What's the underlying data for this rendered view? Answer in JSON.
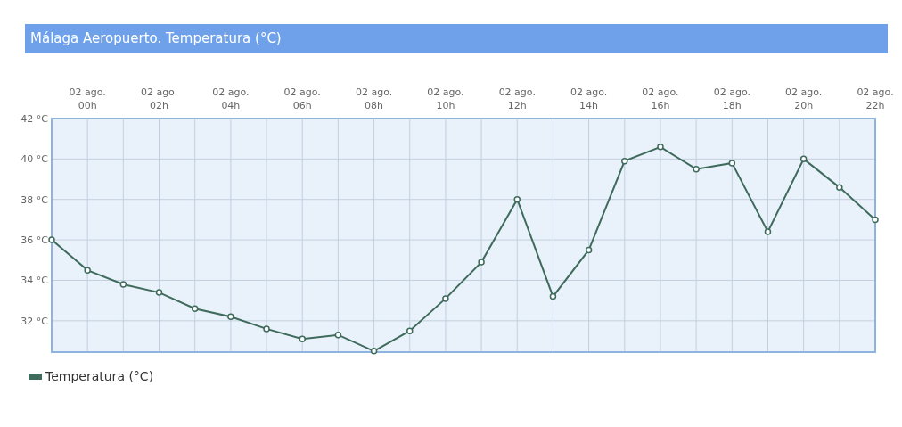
{
  "title": "Málaga Aeropuerto. Temperatura (°C)",
  "chart": {
    "chart_data": {
      "type": "line",
      "categories": [
        null,
        "02 ago. 00h",
        null,
        "02 ago. 02h",
        null,
        "02 ago. 04h",
        null,
        "02 ago. 06h",
        null,
        "02 ago. 08h",
        null,
        "02 ago. 10h",
        null,
        "02 ago. 12h",
        null,
        "02 ago. 14h",
        null,
        "02 ago. 16h",
        null,
        "02 ago. 18h",
        null,
        "02 ago. 20h",
        null,
        "02 ago. 22h"
      ],
      "grid": true,
      "series": [
        {
          "name": "Temperatura (°C)",
          "color": "#3f6b5c",
          "marker": "circle",
          "values": [
            36.0,
            34.5,
            33.8,
            33.4,
            32.6,
            32.2,
            31.6,
            31.1,
            31.3,
            30.5,
            31.5,
            33.1,
            34.9,
            38.0,
            33.2,
            35.5,
            39.9,
            40.6,
            39.5,
            39.8,
            36.4,
            40.0,
            38.6,
            37.0
          ]
        }
      ],
      "ylim": [
        30.45,
        42
      ],
      "yticks": [
        {
          "value": 32,
          "label": "32 °C"
        },
        {
          "value": 34,
          "label": "34 °C"
        },
        {
          "value": 36,
          "label": "36 °C"
        },
        {
          "value": 38,
          "label": "38 °C"
        },
        {
          "value": 40,
          "label": "40 °C"
        },
        {
          "value": 42,
          "label": "42 °C"
        }
      ]
    }
  }
}
